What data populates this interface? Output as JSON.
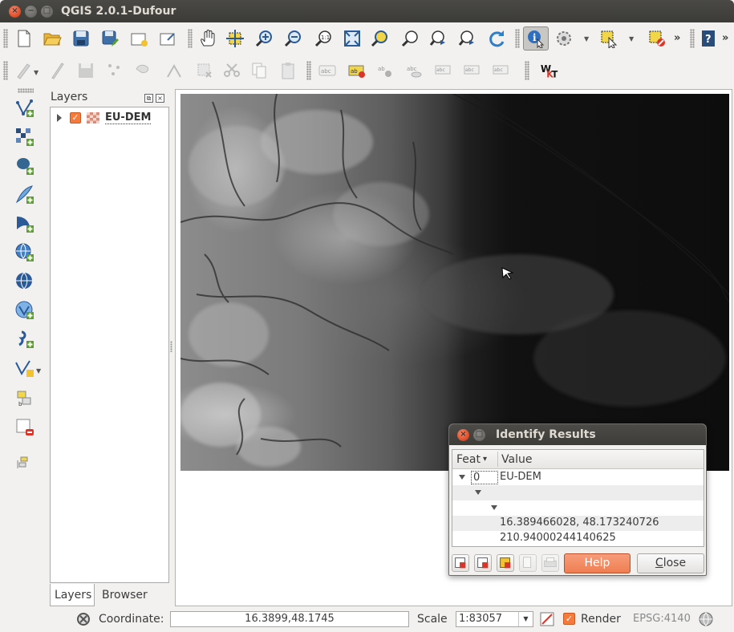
{
  "window": {
    "title": "QGIS 2.0.1-Dufour",
    "close_glyph": "×",
    "min_glyph": "−",
    "max_glyph": "□"
  },
  "toolbar_overflow": "»",
  "layers_panel": {
    "title": "Layers",
    "float_glyph": "⧉",
    "close_glyph": "×",
    "layers": [
      {
        "name": "EU-DEM",
        "checked": true,
        "check_glyph": "✓",
        "type": "raster"
      }
    ],
    "tabs": [
      "Layers",
      "Browser"
    ],
    "active_tab": "Layers"
  },
  "identify_dialog": {
    "title": "Identify Results",
    "columns": [
      "Feat",
      "Value"
    ],
    "sort_glyph": "▾",
    "rows": [
      {
        "feat": "0",
        "value": "EU-DEM"
      },
      {
        "feat": "",
        "value": ""
      },
      {
        "feat": "",
        "value": ""
      },
      {
        "feat": "",
        "value": "16.389466028, 48.173240726"
      },
      {
        "feat": "",
        "value": "210.94000244140625"
      }
    ],
    "help_label": "Help",
    "close_label_first": "C",
    "close_label_rest": "lose"
  },
  "statusbar": {
    "coordinate_label": "Coordinate:",
    "coordinate_value": "16.3899,48.1745",
    "scale_label": "Scale",
    "scale_value": "1:83057",
    "scale_arrow": "▼",
    "render_label": "Render",
    "render_checked": true,
    "render_glyph": "✓",
    "crs": "EPSG:4140"
  },
  "colors": {
    "accent_orange": "#f57b3c",
    "help_button": "#ef7e52",
    "titlebar": "#3c3b37"
  }
}
